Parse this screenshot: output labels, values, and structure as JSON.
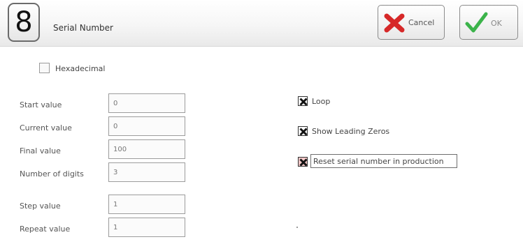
{
  "header": {
    "icon_digit": "8",
    "title": "Serial Number",
    "cancel_label": "Cancel",
    "ok_label": "OK"
  },
  "options": {
    "hexadecimal": {
      "label": "Hexadecimal",
      "checked": false
    }
  },
  "fields": [
    {
      "label": "Start value",
      "value": "0"
    },
    {
      "label": "Current value",
      "value": "0"
    },
    {
      "label": "Final value",
      "value": "100"
    },
    {
      "label": "Number of digits",
      "value": "3"
    },
    {
      "label": "Step value",
      "value": "1"
    },
    {
      "label": "Repeat value",
      "value": "1"
    }
  ],
  "toggles": [
    {
      "label": "Loop",
      "checked": true
    },
    {
      "label": "Show Leading Zeros",
      "checked": true
    },
    {
      "label": "Reset serial number in production",
      "checked": true
    }
  ],
  "icons": {
    "cancel": "red-x-icon",
    "ok": "green-check-icon"
  },
  "colors": {
    "cancel_x": "#d62828",
    "ok_check": "#3bb34a",
    "reset_x": "#c53030"
  }
}
